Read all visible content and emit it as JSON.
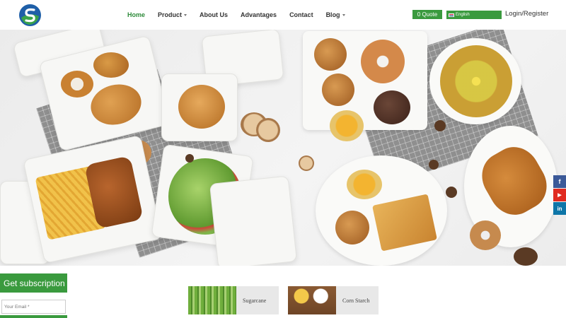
{
  "header": {
    "logo_icon": "company-logo",
    "nav": [
      {
        "label": "Home",
        "active": true,
        "has_dropdown": false
      },
      {
        "label": "Product",
        "active": false,
        "has_dropdown": true
      },
      {
        "label": "About Us",
        "active": false,
        "has_dropdown": false
      },
      {
        "label": "Advantages",
        "active": false,
        "has_dropdown": false
      },
      {
        "label": "Contact",
        "active": false,
        "has_dropdown": false
      },
      {
        "label": "Blog",
        "active": false,
        "has_dropdown": true
      }
    ],
    "quote_label": "0 Quote",
    "language": "English",
    "login_label": "Login/Register"
  },
  "social": [
    {
      "name": "facebook",
      "glyph": "f",
      "color": "#3b5998"
    },
    {
      "name": "youtube",
      "glyph": "▶",
      "color": "#e02a20"
    },
    {
      "name": "linkedin",
      "glyph": "in",
      "color": "#0e76a8"
    }
  ],
  "subscription": {
    "title": "Get subscription",
    "email_placeholder": "Your Email *"
  },
  "materials": [
    {
      "label": "Sugarcane"
    },
    {
      "label": "Corn Starch"
    }
  ],
  "colors": {
    "brand_green": "#3a9a3e",
    "nav_active": "#2e8b3a"
  }
}
